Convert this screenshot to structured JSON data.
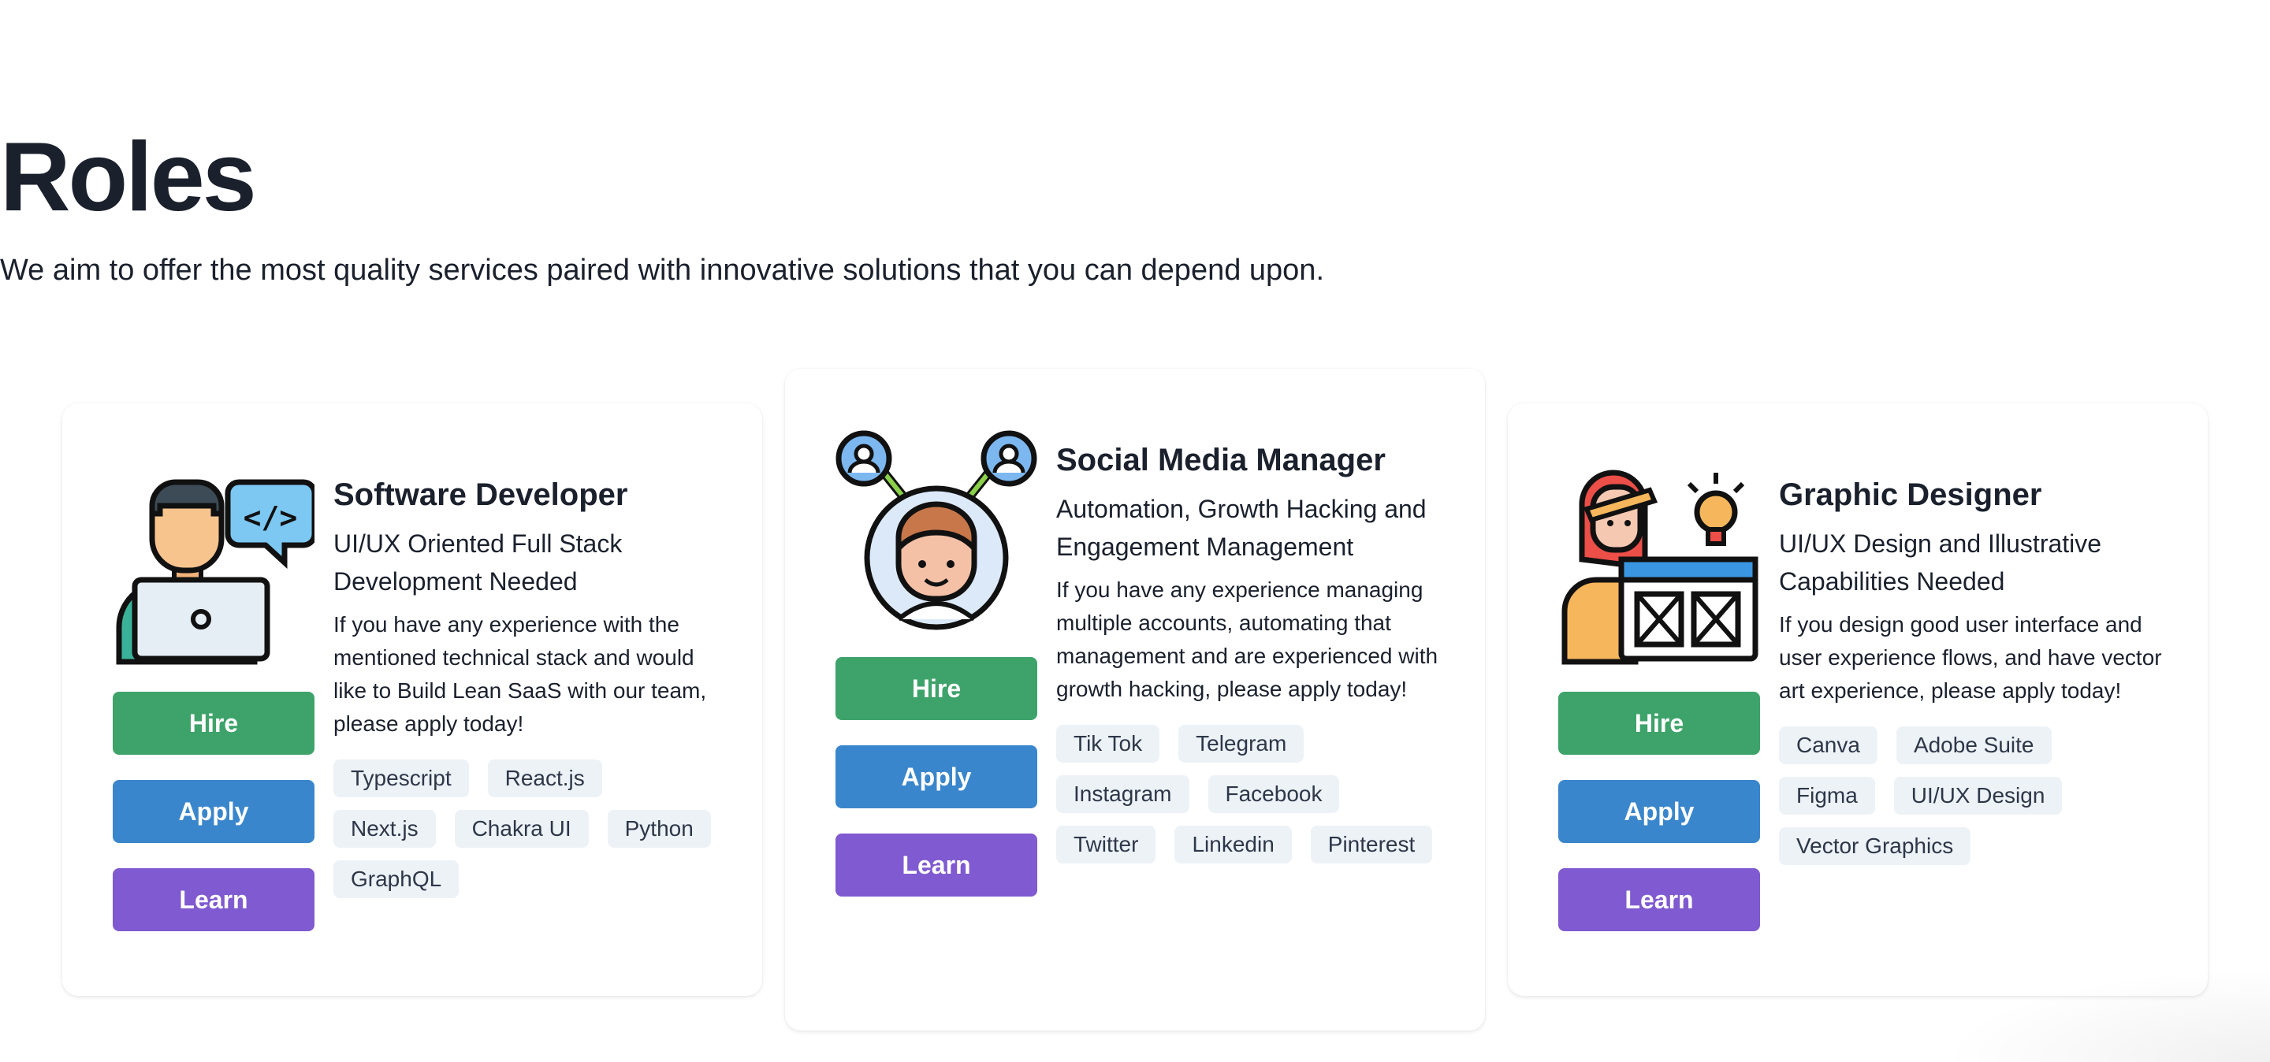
{
  "page": {
    "title": "Roles",
    "subtitle": "We aim to offer the most quality services paired with innovative solutions that you can depend upon."
  },
  "colors": {
    "hire": "#3ea36a",
    "apply": "#3a86cc",
    "learn": "#7f5ad0",
    "chip_bg": "#edf2f7"
  },
  "cards": [
    {
      "icon": "software-developer-illustration",
      "name": "Software Developer",
      "tagline": "UI/UX Oriented Full Stack Development Needed",
      "description": "If you have any experience with the mentioned technical stack and would like to Build Lean SaaS with our team, please apply today!",
      "hire_label": "Hire",
      "apply_label": "Apply",
      "learn_label": "Learn",
      "skills": [
        "Typescript",
        "React.js",
        "Next.js",
        "Chakra UI",
        "Python",
        "GraphQL"
      ]
    },
    {
      "icon": "social-media-manager-illustration",
      "name": "Social Media Manager",
      "tagline": "Automation, Growth Hacking and Engagement Management",
      "description": "If you have any experience managing multiple accounts, automating that management and are experienced with growth hacking, please apply today!",
      "hire_label": "Hire",
      "apply_label": "Apply",
      "learn_label": "Learn",
      "skills": [
        "Tik Tok",
        "Telegram",
        "Instagram",
        "Facebook",
        "Twitter",
        "Linkedin",
        "Pinterest"
      ]
    },
    {
      "icon": "graphic-designer-illustration",
      "name": "Graphic Designer",
      "tagline": "UI/UX Design and Illustrative Capabilities Needed",
      "description": "If you design good user interface and user experience flows, and have vector art experience, please apply today!",
      "hire_label": "Hire",
      "apply_label": "Apply",
      "learn_label": "Learn",
      "skills": [
        "Canva",
        "Adobe Suite",
        "Figma",
        "UI/UX Design",
        "Vector Graphics"
      ]
    }
  ]
}
